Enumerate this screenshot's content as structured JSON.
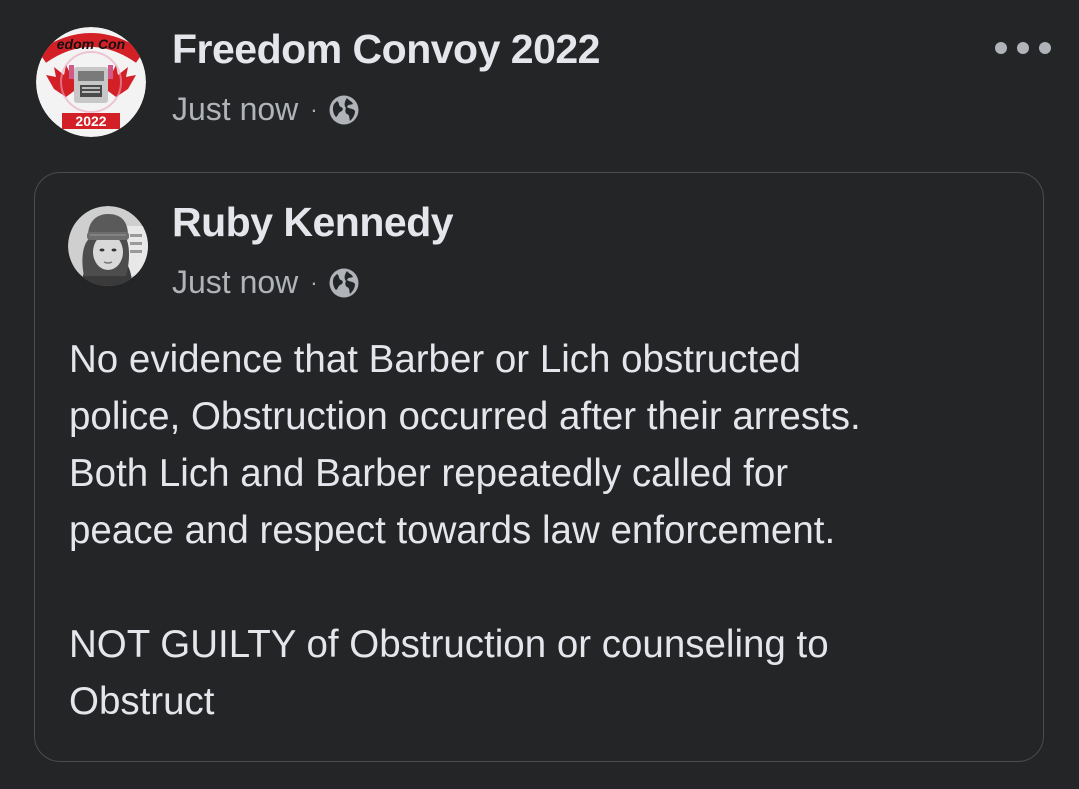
{
  "post": {
    "page_name": "Freedom Convoy 2022",
    "timestamp": "Just now",
    "separator": "·",
    "privacy_icon": "globe-icon",
    "more_icon": "more-options-icon",
    "avatar": {
      "arc_text": "edom Con",
      "year_text": "2022"
    }
  },
  "shared_post": {
    "author_name": "Ruby Kennedy",
    "timestamp": "Just now",
    "separator": "·",
    "privacy_icon": "globe-icon",
    "text": "No evidence that Barber or Lich obstructed\npolice, Obstruction occurred after their arrests.\nBoth Lich and Barber repeatedly called for\npeace and respect towards law enforcement.\n\nNOT GUILTY of Obstruction or counseling to\nObstruct"
  },
  "colors": {
    "background": "#242526",
    "primary_text": "#e4e6eb",
    "secondary_text": "#b0b3b8",
    "card_border": "#4a4c50",
    "avatar_red": "#d32027"
  }
}
